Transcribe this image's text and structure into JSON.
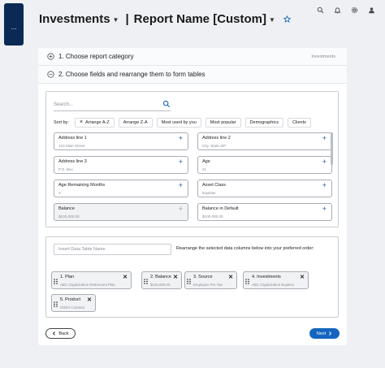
{
  "nav": {
    "menu_label": "..."
  },
  "header": {
    "app": "Investments",
    "separator": "|",
    "report_name": "Report Name [Custom]"
  },
  "steps": [
    {
      "number_label": "1. Choose report category",
      "meta": "Investments"
    },
    {
      "number_label": "2. Choose fields and rearrange them to form tables"
    }
  ],
  "fields": {
    "search_placeholder": "Search...",
    "sort_label": "Sort by:",
    "sort_options": [
      "Arrange A-Z",
      "Arrange Z-A",
      "Most used by you",
      "Most popular",
      "Demographics",
      "Clients"
    ],
    "items": [
      {
        "name": "Address line 1",
        "value": "123 Main Street"
      },
      {
        "name": "Address line 2",
        "value": "City, State ZIP"
      },
      {
        "name": "Address line 3",
        "value": "P.O. Box"
      },
      {
        "name": "Age",
        "value": "21"
      },
      {
        "name": "Age Remaining Months",
        "value": "3"
      },
      {
        "name": "Asset Class",
        "value": "Equities"
      },
      {
        "name": "Balance",
        "value": "$100,000.00"
      },
      {
        "name": "Balance in Default",
        "value": "$100,000.00"
      }
    ]
  },
  "selected": {
    "table_name_placeholder": "Insert Data Table Name",
    "instruction": "Rearrange the selected data columns below into your preferred order:",
    "columns": [
      {
        "name": "1. Plan",
        "value": "ABC Organization Retirement Plan"
      },
      {
        "name": "2. Balance",
        "value": "$100,000.00"
      },
      {
        "name": "3. Source",
        "value": "Employee Pre-Tax"
      },
      {
        "name": "4. Investments",
        "value": "ABC Organization Equities"
      },
      {
        "name": "5. Product",
        "value": "GSRA Contract"
      }
    ]
  },
  "footer": {
    "back_label": "Back",
    "next_label": "Next"
  },
  "colors": {
    "nav": "#0a2a55",
    "accent": "#1565c0"
  }
}
